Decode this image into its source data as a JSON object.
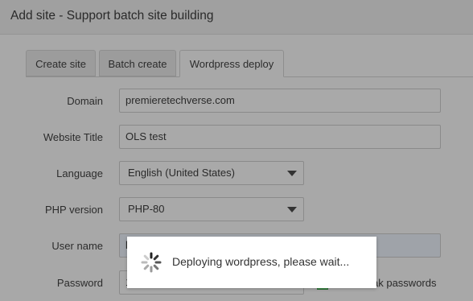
{
  "dialog": {
    "title": "Add site - Support batch site building"
  },
  "tabs": [
    {
      "label": "Create site",
      "active": false
    },
    {
      "label": "Batch create",
      "active": false
    },
    {
      "label": "Wordpress deploy",
      "active": true
    }
  ],
  "form": {
    "domain": {
      "label": "Domain",
      "value": "premieretechverse.com"
    },
    "website_title": {
      "label": "Website Title",
      "value": "OLS test"
    },
    "language": {
      "label": "Language",
      "value": "English (United States)"
    },
    "php_version": {
      "label": "PHP version",
      "value": "PHP-80"
    },
    "user_name": {
      "label": "User name",
      "value": "k"
    },
    "password": {
      "label": "Password",
      "value": "1"
    },
    "weak_passwords_label": "ak passwords"
  },
  "loading": {
    "message": "Deploying wordpress, please wait..."
  },
  "colors": {
    "checkbox_checked": "#3a8a46",
    "overlay_bg": "#ffffff"
  },
  "icons": {
    "spinner": "loading-spinner-icon",
    "dropdown": "chevron-down-icon"
  }
}
